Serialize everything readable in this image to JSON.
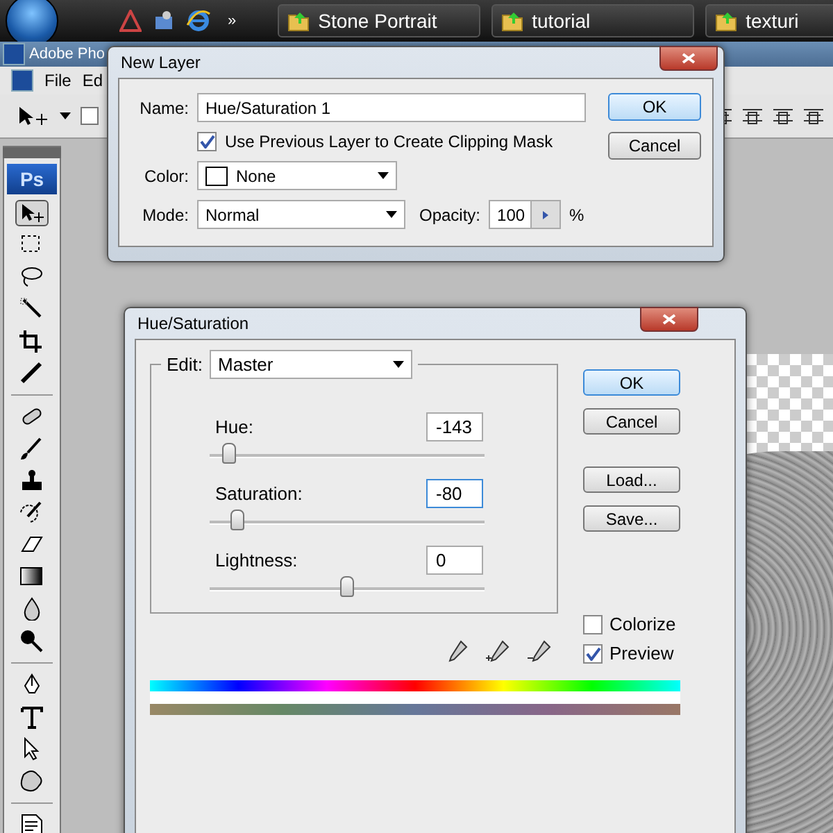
{
  "taskbar": {
    "more": "»",
    "tasks": [
      {
        "label": "Stone Portrait"
      },
      {
        "label": "tutorial"
      },
      {
        "label": "texturi"
      }
    ]
  },
  "app": {
    "title": "Adobe Pho",
    "menu": [
      "File",
      "Ed"
    ],
    "logo": "Ps",
    "option_checked": false,
    "tools": [
      {
        "kind": "move",
        "selected": true
      },
      {
        "kind": "marquee",
        "selected": false
      },
      {
        "kind": "lasso",
        "selected": false
      },
      {
        "kind": "wand",
        "selected": false
      },
      {
        "kind": "crop",
        "selected": false
      },
      {
        "kind": "slice",
        "selected": false
      },
      {
        "kind": "heal",
        "selected": false
      },
      {
        "kind": "brush",
        "selected": false
      },
      {
        "kind": "stamp",
        "selected": false
      },
      {
        "kind": "history",
        "selected": false
      },
      {
        "kind": "eraser",
        "selected": false
      },
      {
        "kind": "gradient",
        "selected": false
      },
      {
        "kind": "blur",
        "selected": false
      },
      {
        "kind": "dodge",
        "selected": false
      },
      {
        "kind": "pen",
        "selected": false
      },
      {
        "kind": "type",
        "selected": false
      },
      {
        "kind": "pointer",
        "selected": false
      },
      {
        "kind": "shape",
        "selected": false
      },
      {
        "kind": "notes",
        "selected": false
      }
    ]
  },
  "new_layer_dialog": {
    "title": "New Layer",
    "name_label": "Name:",
    "name_value": "Hue/Saturation 1",
    "clipping_label": "Use Previous Layer to Create Clipping Mask",
    "clipping_checked": true,
    "color_label": "Color:",
    "color_value": "None",
    "mode_label": "Mode:",
    "mode_value": "Normal",
    "opacity_label": "Opacity:",
    "opacity_value": "100",
    "opacity_unit": "%",
    "buttons": [
      "OK",
      "Cancel"
    ]
  },
  "hue_saturation_dialog": {
    "title": "Hue/Saturation",
    "edit_label": "Edit:",
    "edit_value": "Master",
    "sliders": [
      {
        "label": "Hue:",
        "value": "-143",
        "level": 0.07,
        "focused": false
      },
      {
        "label": "Saturation:",
        "value": "-80",
        "level": 0.1,
        "focused": true
      },
      {
        "label": "Lightness:",
        "value": "0",
        "level": 0.5,
        "focused": false
      }
    ],
    "buttons": [
      "OK",
      "Cancel",
      "Load...",
      "Save..."
    ],
    "checkboxes": [
      {
        "label": "Colorize",
        "checked": false
      },
      {
        "label": "Preview",
        "checked": true
      }
    ]
  }
}
